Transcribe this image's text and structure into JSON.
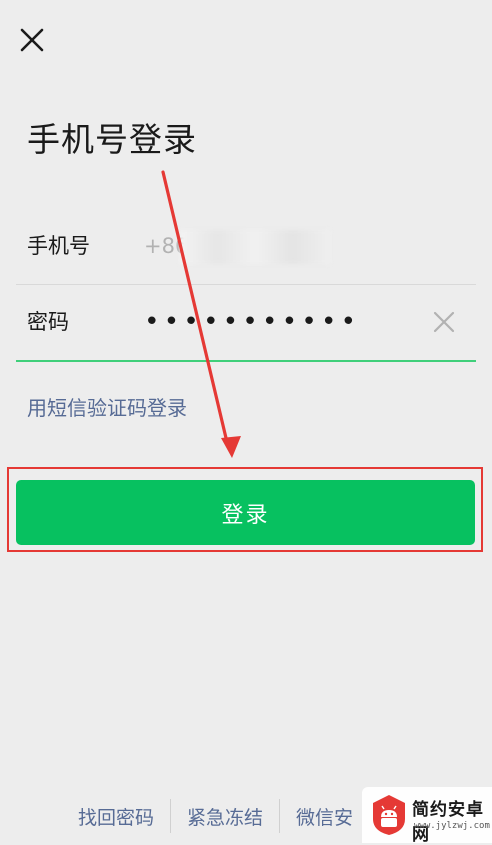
{
  "header": {
    "close_icon": "close-icon"
  },
  "title": "手机号登录",
  "form": {
    "phone": {
      "label": "手机号",
      "value": "+86"
    },
    "password": {
      "label": "密码",
      "value": "•••••••••••",
      "clear_icon": "close-icon"
    }
  },
  "sms_login_link": "用短信验证码登录",
  "login_button": "登录",
  "footer": {
    "links": [
      "找回密码",
      "紧急冻结",
      "微信安"
    ]
  },
  "watermark": {
    "title": "简约安卓网",
    "url": "www.jylzwj.com"
  },
  "colors": {
    "background": "#ededed",
    "primary": "#07c160",
    "link": "#576b95",
    "active_underline": "#3fcf7a",
    "annotation": "#e53935"
  }
}
